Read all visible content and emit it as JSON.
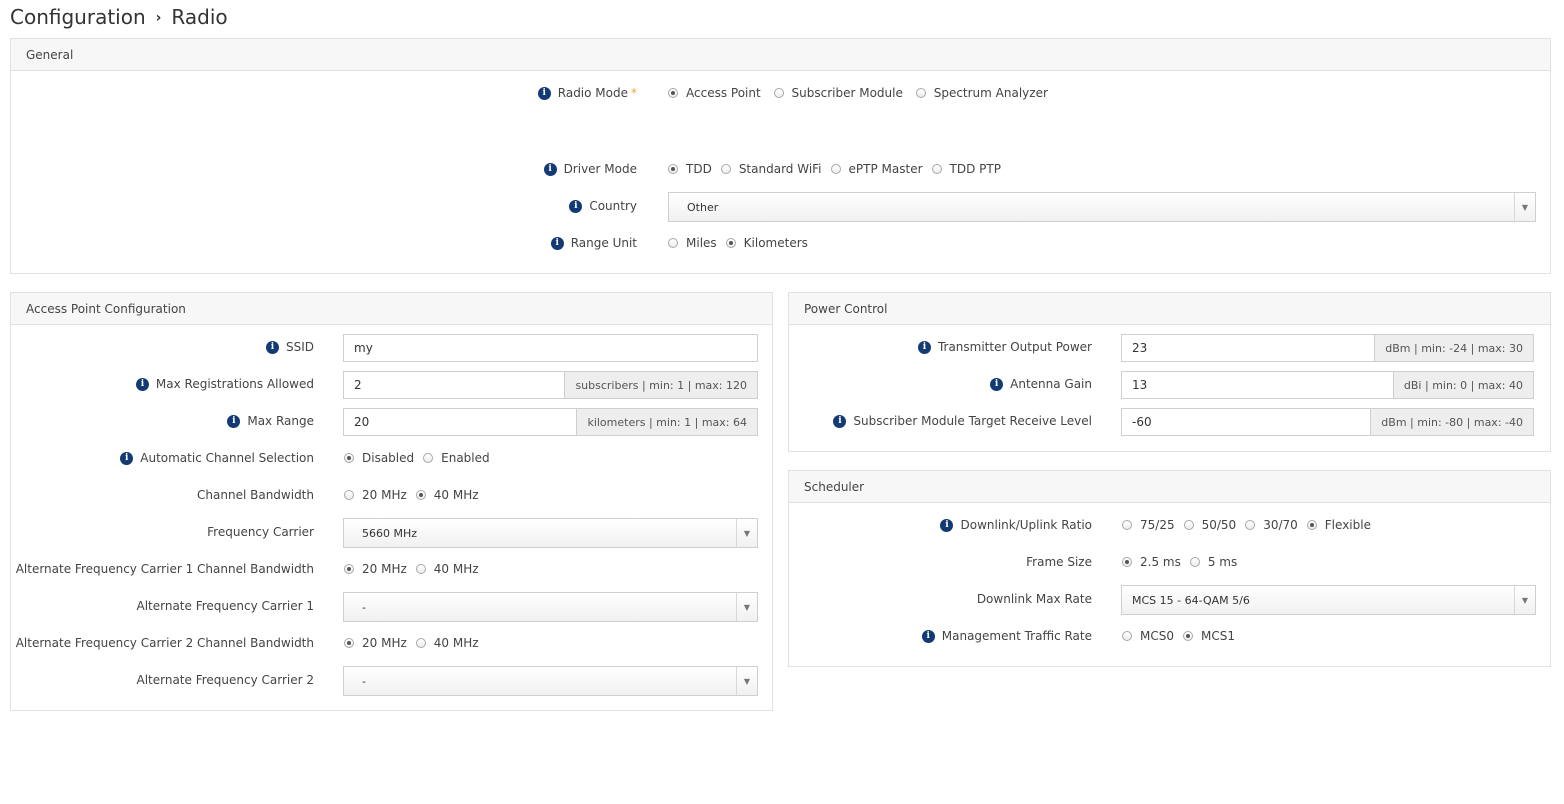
{
  "breadcrumb": {
    "root": "Configuration",
    "separator": "›",
    "current": "Radio"
  },
  "general": {
    "title": "General",
    "radio_mode": {
      "label": "Radio Mode",
      "required": "*",
      "options": [
        "Access Point",
        "Subscriber Module",
        "Spectrum Analyzer"
      ],
      "selected": 0
    },
    "driver_mode": {
      "label": "Driver Mode",
      "options": [
        "TDD",
        "Standard WiFi",
        "ePTP Master",
        "TDD PTP"
      ],
      "selected": 0
    },
    "country": {
      "label": "Country",
      "value": "Other"
    },
    "range_unit": {
      "label": "Range Unit",
      "options": [
        "Miles",
        "Kilometers"
      ],
      "selected": 1
    }
  },
  "ap": {
    "title": "Access Point Configuration",
    "ssid": {
      "label": "SSID",
      "value": "my"
    },
    "max_reg": {
      "label": "Max Registrations Allowed",
      "value": "2",
      "addon": "subscribers | min: 1 | max: 120"
    },
    "max_range": {
      "label": "Max Range",
      "value": "20",
      "addon": "kilometers | min: 1 | max: 64"
    },
    "acs": {
      "label": "Automatic Channel Selection",
      "options": [
        "Disabled",
        "Enabled"
      ],
      "selected": 0
    },
    "bandwidth": {
      "label": "Channel Bandwidth",
      "options": [
        "20 MHz",
        "40 MHz"
      ],
      "selected": 1
    },
    "freq": {
      "label": "Frequency Carrier",
      "value": "5660 MHz"
    },
    "alt1_bw": {
      "label": "Alternate Frequency Carrier 1 Channel Bandwidth",
      "options": [
        "20 MHz",
        "40 MHz"
      ],
      "selected": 0
    },
    "alt1": {
      "label": "Alternate Frequency Carrier 1",
      "value": "-"
    },
    "alt2_bw": {
      "label": "Alternate Frequency Carrier 2 Channel Bandwidth",
      "options": [
        "20 MHz",
        "40 MHz"
      ],
      "selected": 0
    },
    "alt2": {
      "label": "Alternate Frequency Carrier 2",
      "value": "-"
    }
  },
  "power": {
    "title": "Power Control",
    "tx": {
      "label": "Transmitter Output Power",
      "value": "23",
      "addon": "dBm | min: -24 | max: 30"
    },
    "gain": {
      "label": "Antenna Gain",
      "value": "13",
      "addon": "dBi | min: 0 | max: 40"
    },
    "sm_rx": {
      "label": "Subscriber Module Target Receive Level",
      "value": "-60",
      "addon": "dBm | min: -80 | max: -40"
    }
  },
  "scheduler": {
    "title": "Scheduler",
    "ratio": {
      "label": "Downlink/Uplink Ratio",
      "options": [
        "75/25",
        "50/50",
        "30/70",
        "Flexible"
      ],
      "selected": 3
    },
    "frame": {
      "label": "Frame Size",
      "options": [
        "2.5 ms",
        "5 ms"
      ],
      "selected": 0
    },
    "dl_rate": {
      "label": "Downlink Max Rate",
      "value": "MCS 15 - 64-QAM 5/6"
    },
    "mgmt": {
      "label": "Management Traffic Rate",
      "options": [
        "MCS0",
        "MCS1"
      ],
      "selected": 1
    }
  },
  "icons": {
    "info": "info-icon",
    "dropdown": "chevron-down-icon"
  },
  "colors": {
    "info_icon": "#133a73",
    "required": "#e8a13a"
  }
}
